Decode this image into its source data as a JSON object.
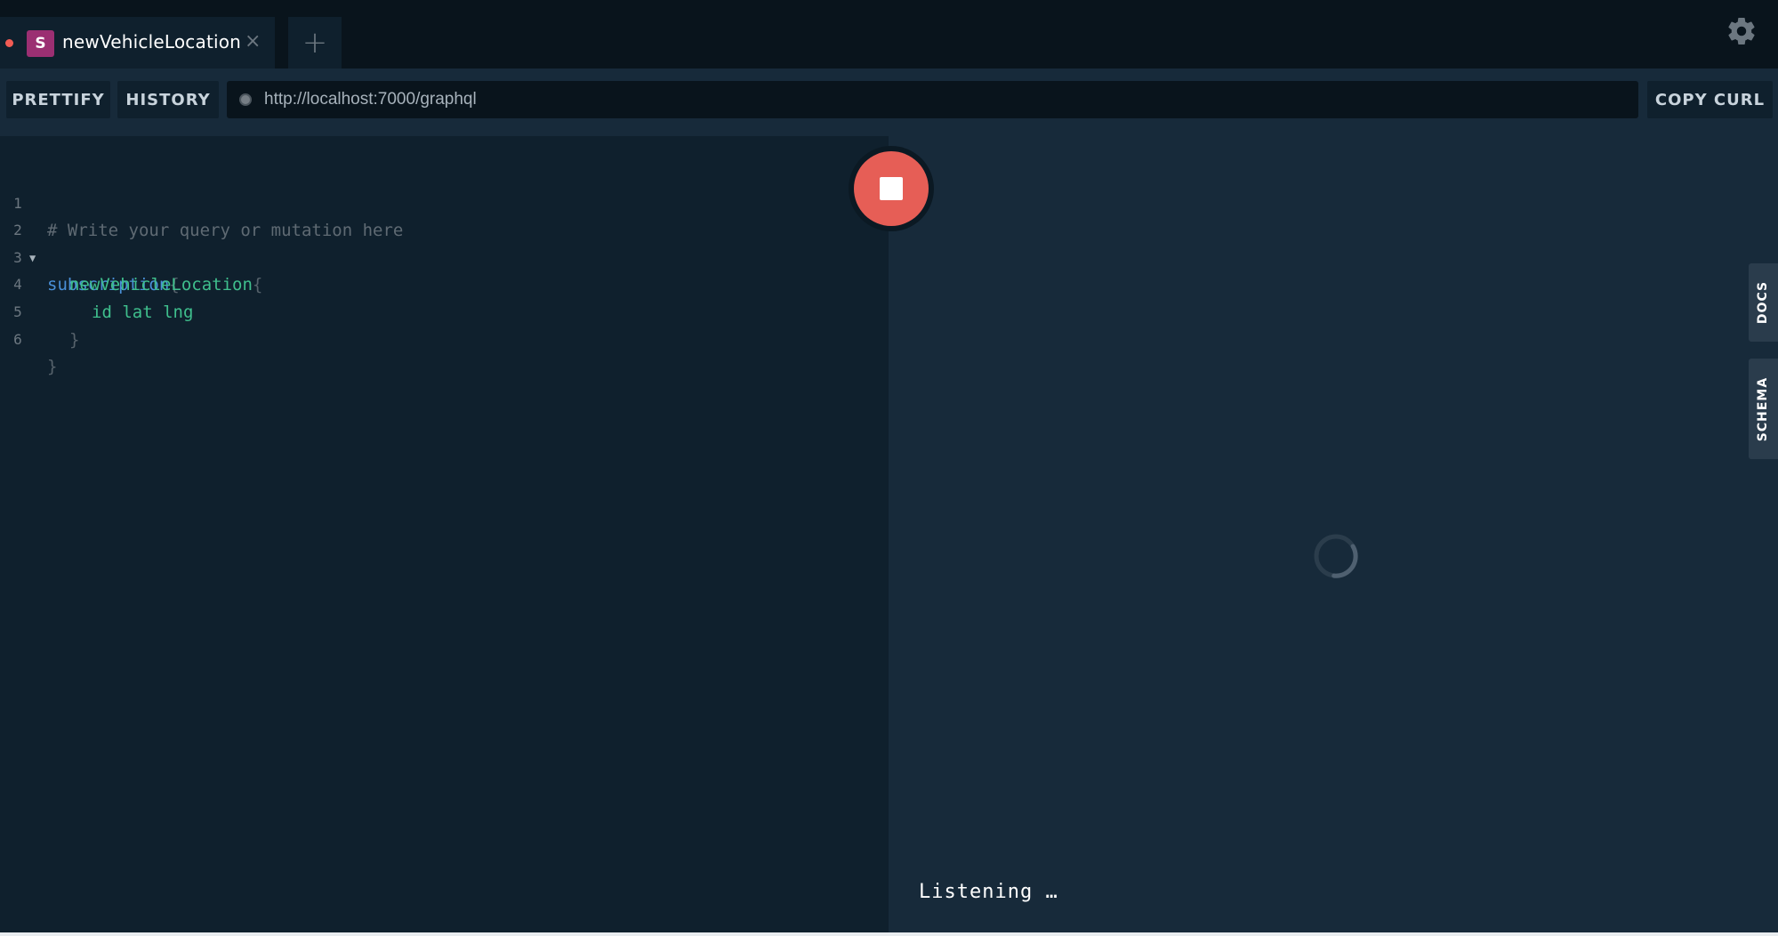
{
  "tab": {
    "badge": "S",
    "title": "newVehicleLocation",
    "close_icon": "×",
    "add_icon": "+"
  },
  "settings_icon": "gear-icon",
  "toolbar": {
    "prettify_label": "PRETTIFY",
    "history_label": "HISTORY",
    "url": "http://localhost:7000/graphql",
    "copy_curl_label": "COPY CURL"
  },
  "editor": {
    "lines": [
      {
        "number": "1",
        "text": "# Write your query or mutation here"
      },
      {
        "number": "2",
        "text": "subscription",
        "after": "{"
      },
      {
        "number": "3",
        "text": "newVehicleLocation",
        "after": "{"
      },
      {
        "number": "4",
        "text": "id lat lng"
      },
      {
        "number": "5",
        "text": "}"
      },
      {
        "number": "6",
        "text": "}"
      }
    ]
  },
  "result": {
    "status": "Listening …"
  },
  "side_tabs": {
    "docs": "DOCS",
    "schema": "SCHEMA"
  },
  "colors": {
    "accent_stop": "#e65e56",
    "badge": "#9b2f72",
    "keyword": "#4a90d9",
    "field": "#3fbf8d"
  }
}
